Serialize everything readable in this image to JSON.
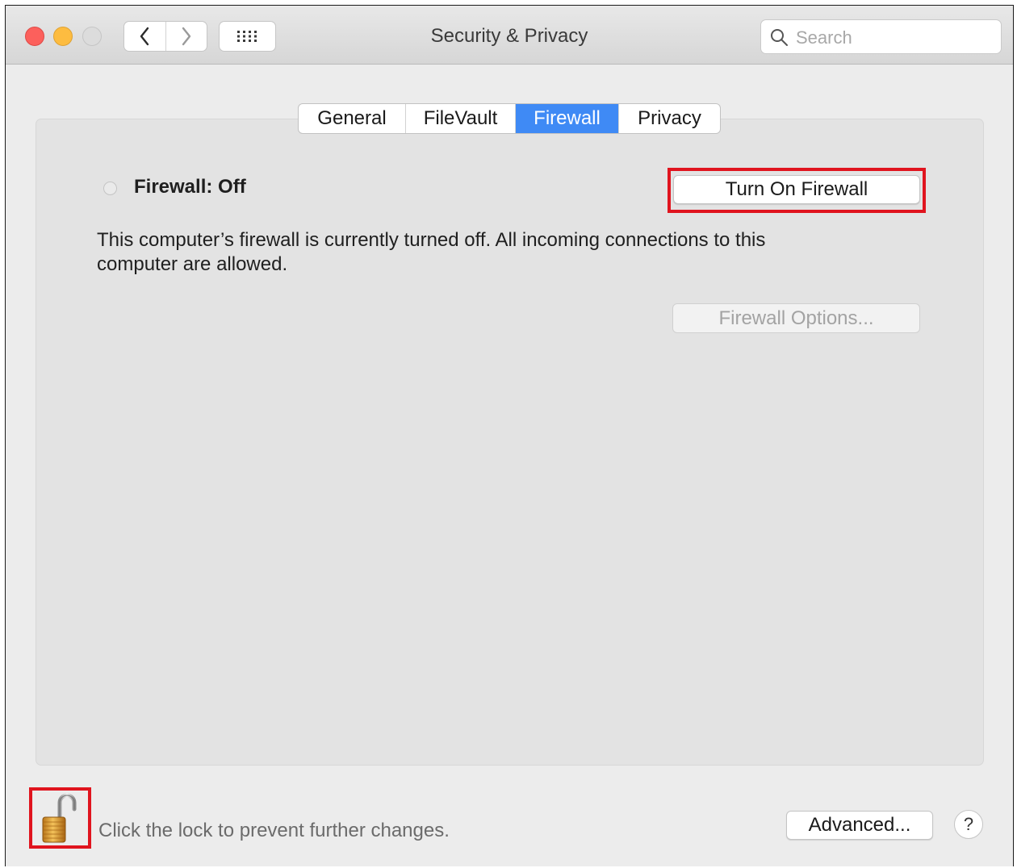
{
  "window": {
    "title": "Security & Privacy"
  },
  "toolbar": {
    "back_icon": "chevron-left-icon",
    "forward_icon": "chevron-right-icon",
    "grid_icon": "grid-dots-icon"
  },
  "search": {
    "placeholder": "Search",
    "icon": "search-icon"
  },
  "tabs": [
    {
      "label": "General",
      "active": false
    },
    {
      "label": "FileVault",
      "active": false
    },
    {
      "label": "Firewall",
      "active": true
    },
    {
      "label": "Privacy",
      "active": false
    }
  ],
  "firewall": {
    "status_label": "Firewall: Off",
    "turn_on_button": "Turn On Firewall",
    "description": "This computer’s firewall is currently turned off. All incoming connections to this computer are allowed.",
    "options_button": "Firewall Options..."
  },
  "footer": {
    "lock_text": "Click the lock to prevent further changes.",
    "lock_icon": "unlocked-padlock-icon",
    "advanced_button": "Advanced...",
    "help_label": "?"
  },
  "colors": {
    "active_tab": "#3f8af5",
    "highlight": "#e0141e",
    "close": "#fc605c",
    "minimize": "#fdbc40"
  }
}
